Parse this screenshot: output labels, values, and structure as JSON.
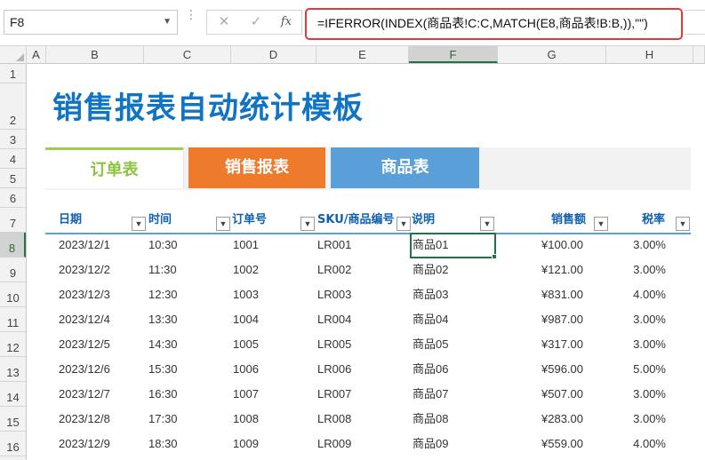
{
  "formula_bar": {
    "name_box": "F8",
    "cancel_icon": "✕",
    "enter_icon": "✓",
    "fx_icon": "fx",
    "formula": "=IFERROR(INDEX(商品表!C:C,MATCH(E8,商品表!B:B,)),\"\")"
  },
  "columns": [
    "A",
    "B",
    "C",
    "D",
    "E",
    "F",
    "G",
    "H"
  ],
  "rows": [
    "1",
    "2",
    "3",
    "4",
    "5",
    "6",
    "7",
    "8",
    "9",
    "10",
    "11",
    "12",
    "13",
    "14",
    "15",
    "16"
  ],
  "active_cell": {
    "column": "F",
    "row": "8"
  },
  "title": "销售报表自动统计模板",
  "tabs": [
    {
      "label": "订单表",
      "active": true,
      "color": "#8dc23f"
    },
    {
      "label": "销售报表",
      "active": false,
      "color": "#ee7a2c"
    },
    {
      "label": "商品表",
      "active": false,
      "color": "#5b9fd8"
    }
  ],
  "table": {
    "headers": [
      "日期",
      "时间",
      "订单号",
      "SKU/商品编号",
      "说明",
      "销售额",
      "税率"
    ],
    "rows": [
      [
        "2023/12/1",
        "10:30",
        "1001",
        "LR001",
        "商品01",
        "¥100.00",
        "3.00%"
      ],
      [
        "2023/12/2",
        "11:30",
        "1002",
        "LR002",
        "商品02",
        "¥121.00",
        "3.00%"
      ],
      [
        "2023/12/3",
        "12:30",
        "1003",
        "LR003",
        "商品03",
        "¥831.00",
        "4.00%"
      ],
      [
        "2023/12/4",
        "13:30",
        "1004",
        "LR004",
        "商品04",
        "¥987.00",
        "3.00%"
      ],
      [
        "2023/12/5",
        "14:30",
        "1005",
        "LR005",
        "商品05",
        "¥317.00",
        "3.00%"
      ],
      [
        "2023/12/6",
        "15:30",
        "1006",
        "LR006",
        "商品06",
        "¥596.00",
        "5.00%"
      ],
      [
        "2023/12/7",
        "16:30",
        "1007",
        "LR007",
        "商品07",
        "¥507.00",
        "3.00%"
      ],
      [
        "2023/12/8",
        "17:30",
        "1008",
        "LR008",
        "商品08",
        "¥283.00",
        "3.00%"
      ],
      [
        "2023/12/9",
        "18:30",
        "1009",
        "LR009",
        "商品09",
        "¥559.00",
        "4.00%"
      ]
    ]
  },
  "colors": {
    "title": "#1074c4",
    "header_text": "#1060b0",
    "selection": "#217346",
    "formula_highlight": "#e03a3a"
  }
}
